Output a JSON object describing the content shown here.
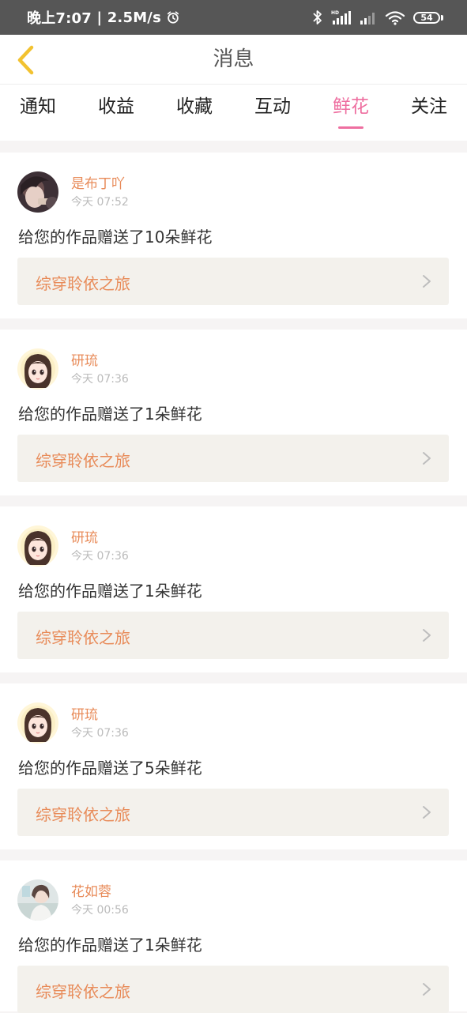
{
  "status_bar": {
    "time": "晚上7:07",
    "speed": "2.5M/s",
    "battery": "54"
  },
  "header": {
    "title": "消息"
  },
  "tabs": [
    {
      "label": "通知",
      "active": false
    },
    {
      "label": "收益",
      "active": false
    },
    {
      "label": "收藏",
      "active": false
    },
    {
      "label": "互动",
      "active": false
    },
    {
      "label": "鲜花",
      "active": true
    },
    {
      "label": "关注",
      "active": false
    }
  ],
  "messages": [
    {
      "user": "是布丁吖",
      "time": "今天 07:52",
      "text": "给您的作品赠送了10朵鲜花",
      "work": "综穿聆依之旅",
      "avatar": "avatar-photo-1"
    },
    {
      "user": "研琉",
      "time": "今天 07:36",
      "text": "给您的作品赠送了1朵鲜花",
      "work": "综穿聆依之旅",
      "avatar": "avatar-cartoon-girl"
    },
    {
      "user": "研琉",
      "time": "今天 07:36",
      "text": "给您的作品赠送了1朵鲜花",
      "work": "综穿聆依之旅",
      "avatar": "avatar-cartoon-girl"
    },
    {
      "user": "研琉",
      "time": "今天 07:36",
      "text": "给您的作品赠送了5朵鲜花",
      "work": "综穿聆依之旅",
      "avatar": "avatar-cartoon-girl"
    },
    {
      "user": "花如蓉",
      "time": "今天 00:56",
      "text": "给您的作品赠送了1朵鲜花",
      "work": "综穿聆依之旅",
      "avatar": "avatar-photo-2"
    }
  ],
  "colors": {
    "accent": "#ee6fa0",
    "username": "#e88b59",
    "back_arrow": "#f2c230",
    "status_bar_bg": "#565656"
  }
}
